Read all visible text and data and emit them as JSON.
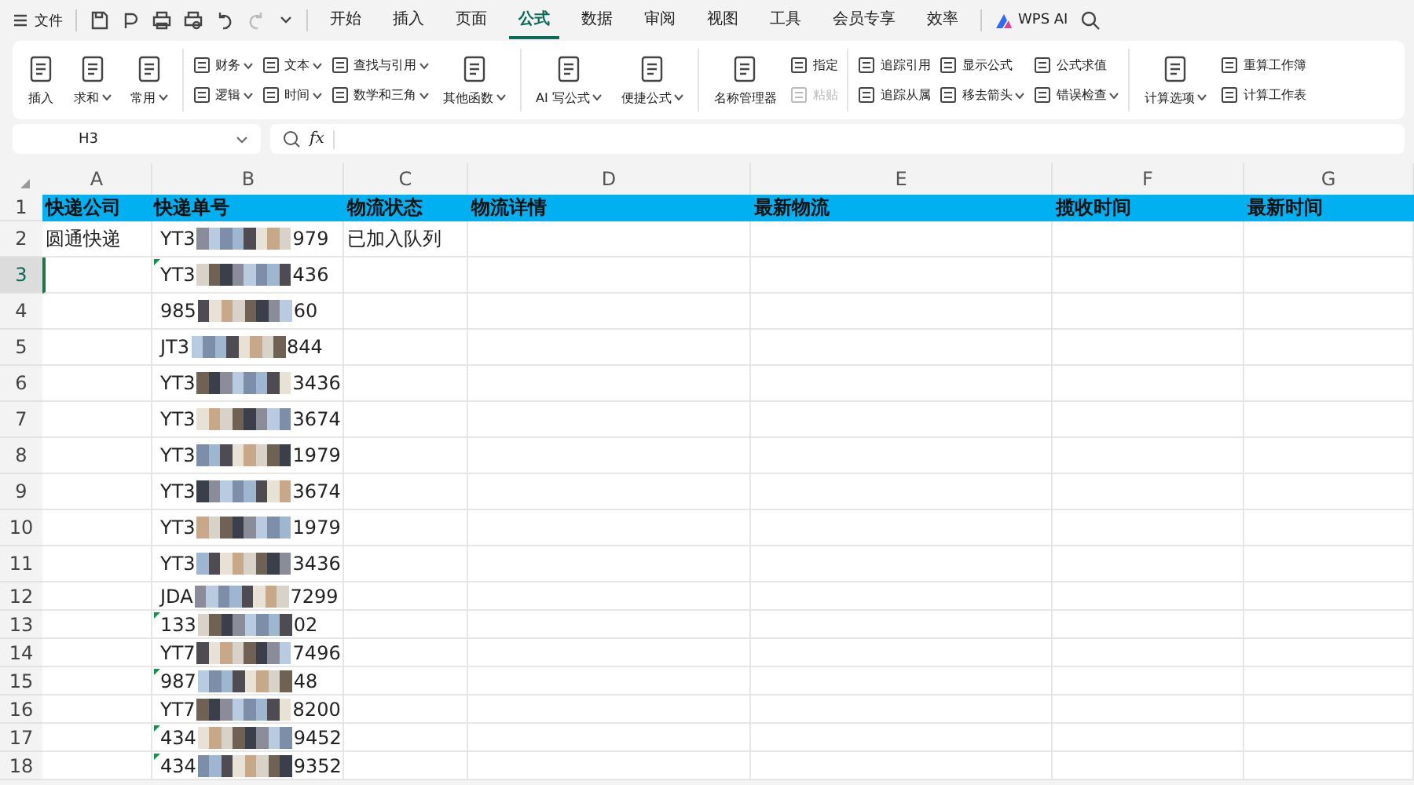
{
  "menu": {
    "file_label": "文件"
  },
  "tabs": [
    {
      "label": "开始",
      "selected": false
    },
    {
      "label": "插入",
      "selected": false
    },
    {
      "label": "页面",
      "selected": false
    },
    {
      "label": "公式",
      "selected": true
    },
    {
      "label": "数据",
      "selected": false
    },
    {
      "label": "审阅",
      "selected": false
    },
    {
      "label": "视图",
      "selected": false
    },
    {
      "label": "工具",
      "selected": false
    },
    {
      "label": "会员专享",
      "selected": false
    },
    {
      "label": "效率",
      "selected": false
    }
  ],
  "ai_button": {
    "label": "WPS AI"
  },
  "ribbon": {
    "groups": [
      {
        "columns": [
          {
            "kind": "large",
            "items": [
              {
                "label": "插入",
                "dropdown": false,
                "disabled": false
              }
            ]
          },
          {
            "kind": "large",
            "items": [
              {
                "label": "求和",
                "dropdown": true,
                "disabled": false
              }
            ]
          },
          {
            "kind": "large",
            "items": [
              {
                "label": "常用",
                "dropdown": true,
                "disabled": false
              }
            ]
          }
        ]
      },
      {
        "columns": [
          {
            "kind": "stack",
            "items": [
              {
                "label": "财务",
                "dropdown": true,
                "disabled": false
              },
              {
                "label": "逻辑",
                "dropdown": true,
                "disabled": false
              }
            ]
          },
          {
            "kind": "stack",
            "items": [
              {
                "label": "文本",
                "dropdown": true,
                "disabled": false
              },
              {
                "label": "时间",
                "dropdown": true,
                "disabled": false
              }
            ]
          },
          {
            "kind": "stack",
            "items": [
              {
                "label": "查找与引用",
                "dropdown": true,
                "disabled": false
              },
              {
                "label": "数学和三角",
                "dropdown": true,
                "disabled": false
              }
            ]
          },
          {
            "kind": "large",
            "items": [
              {
                "label": "其他函数",
                "dropdown": true,
                "disabled": false
              }
            ]
          }
        ]
      },
      {
        "columns": [
          {
            "kind": "large",
            "items": [
              {
                "label": "AI 写公式",
                "dropdown": true,
                "disabled": false
              }
            ]
          },
          {
            "kind": "large",
            "items": [
              {
                "label": "便捷公式",
                "dropdown": true,
                "disabled": false
              }
            ]
          }
        ]
      },
      {
        "columns": [
          {
            "kind": "large",
            "items": [
              {
                "label": "名称管理器",
                "dropdown": false,
                "disabled": false
              }
            ]
          },
          {
            "kind": "stack",
            "items": [
              {
                "label": "指定",
                "dropdown": false,
                "disabled": false
              },
              {
                "label": "粘贴",
                "dropdown": false,
                "disabled": true
              }
            ]
          }
        ]
      },
      {
        "columns": [
          {
            "kind": "stack",
            "items": [
              {
                "label": "追踪引用",
                "dropdown": false,
                "disabled": false
              },
              {
                "label": "追踪从属",
                "dropdown": false,
                "disabled": false
              }
            ]
          },
          {
            "kind": "stack",
            "items": [
              {
                "label": "显示公式",
                "dropdown": false,
                "disabled": false
              },
              {
                "label": "移去箭头",
                "dropdown": true,
                "disabled": false
              }
            ]
          },
          {
            "kind": "stack",
            "items": [
              {
                "label": "公式求值",
                "dropdown": false,
                "disabled": false
              },
              {
                "label": "错误检查",
                "dropdown": true,
                "disabled": false
              }
            ]
          }
        ]
      },
      {
        "columns": [
          {
            "kind": "large",
            "items": [
              {
                "label": "计算选项",
                "dropdown": true,
                "disabled": false
              }
            ]
          },
          {
            "kind": "stack",
            "items": [
              {
                "label": "重算工作簿",
                "dropdown": false,
                "disabled": false
              },
              {
                "label": "计算工作表",
                "dropdown": false,
                "disabled": false
              }
            ]
          }
        ]
      }
    ]
  },
  "formula_bar": {
    "name_box": "H3",
    "fx": "fx"
  },
  "sheet": {
    "columns": [
      "A",
      "B",
      "C",
      "D",
      "E",
      "F",
      "G"
    ],
    "header_row_number": "1",
    "header_row": [
      "快递公司",
      "快递单号",
      "物流状态",
      "物流详情",
      "最新物流",
      "揽收时间",
      "最新时间"
    ],
    "rows": [
      {
        "number": "2",
        "selected": false,
        "company": "圆通快递",
        "tracking_start": "YT3",
        "tracking_end": "979",
        "flag": false,
        "status": "已加入队列"
      },
      {
        "number": "3",
        "selected": true,
        "company": "",
        "tracking_start": "YT3",
        "tracking_end": "436",
        "flag": true,
        "status": ""
      },
      {
        "number": "4",
        "selected": false,
        "company": "",
        "tracking_start": "985",
        "tracking_end": "60",
        "flag": false,
        "status": ""
      },
      {
        "number": "5",
        "selected": false,
        "company": "",
        "tracking_start": "JT3",
        "tracking_end": "844",
        "flag": false,
        "status": ""
      },
      {
        "number": "6",
        "selected": false,
        "company": "",
        "tracking_start": "YT3",
        "tracking_end": "3436",
        "flag": false,
        "status": ""
      },
      {
        "number": "7",
        "selected": false,
        "company": "",
        "tracking_start": "YT3",
        "tracking_end": "3674",
        "flag": false,
        "status": ""
      },
      {
        "number": "8",
        "selected": false,
        "company": "",
        "tracking_start": "YT3",
        "tracking_end": "1979",
        "flag": false,
        "status": ""
      },
      {
        "number": "9",
        "selected": false,
        "company": "",
        "tracking_start": "YT3",
        "tracking_end": "3674",
        "flag": false,
        "status": ""
      },
      {
        "number": "10",
        "selected": false,
        "company": "",
        "tracking_start": "YT3",
        "tracking_end": "1979",
        "flag": false,
        "status": ""
      },
      {
        "number": "11",
        "selected": false,
        "company": "",
        "tracking_start": "YT3",
        "tracking_end": "3436",
        "flag": false,
        "status": ""
      },
      {
        "number": "12",
        "selected": false,
        "company": "",
        "tracking_start": "JDA",
        "tracking_end": "7299",
        "flag": false,
        "status": ""
      },
      {
        "number": "13",
        "selected": false,
        "company": "",
        "tracking_start": "133",
        "tracking_end": "02",
        "flag": true,
        "status": ""
      },
      {
        "number": "14",
        "selected": false,
        "company": "",
        "tracking_start": "YT7",
        "tracking_end": "7496",
        "flag": false,
        "status": ""
      },
      {
        "number": "15",
        "selected": false,
        "company": "",
        "tracking_start": "987",
        "tracking_end": "48",
        "flag": true,
        "status": ""
      },
      {
        "number": "16",
        "selected": false,
        "company": "",
        "tracking_start": "YT7",
        "tracking_end": "8200",
        "flag": false,
        "status": ""
      },
      {
        "number": "17",
        "selected": false,
        "company": "",
        "tracking_start": "434",
        "tracking_end": "9452",
        "flag": true,
        "status": ""
      },
      {
        "number": "18",
        "selected": false,
        "company": "",
        "tracking_start": "434",
        "tracking_end": "9352",
        "flag": true,
        "status": ""
      }
    ]
  }
}
